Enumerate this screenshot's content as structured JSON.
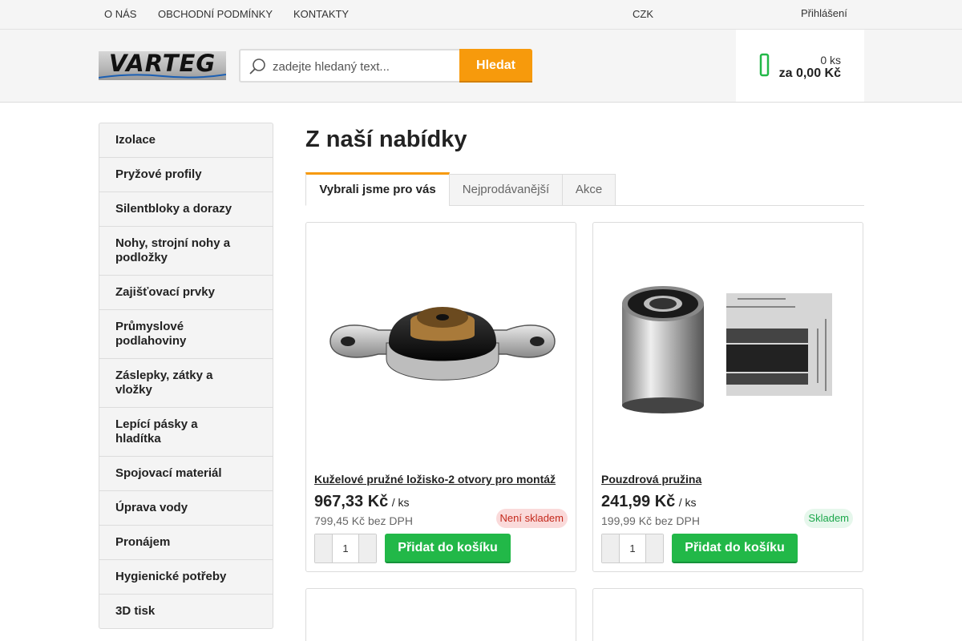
{
  "topbar": {
    "links": [
      "O NÁS",
      "OBCHODNÍ PODMÍNKY",
      "KONTAKTY"
    ],
    "currency_icon": "",
    "currency": "CZK",
    "currency_caret": "",
    "login_icon": "",
    "login": "Přihlášení"
  },
  "header": {
    "logo_text": "VARTEG",
    "search_placeholder": "zadejte hledaný text...",
    "search_button": "Hledat",
    "cart_icon": "",
    "cart_qty": "0 ks",
    "cart_total": "za 0,00 Kč",
    "accent": "#f79a0c"
  },
  "sidebar": {
    "items": [
      {
        "label": "Izolace",
        "arrow": ""
      },
      {
        "label": "Pryžové profily",
        "arrow": ""
      },
      {
        "label": "Silentbloky a dorazy",
        "arrow": ""
      },
      {
        "label": "Nohy, strojní nohy a podložky",
        "arrow": ""
      },
      {
        "label": "Zajišťovací prvky",
        "arrow": ""
      },
      {
        "label": "Průmyslové podlahoviny",
        "arrow": ""
      },
      {
        "label": "Záslepky, zátky a vložky",
        "arrow": ""
      },
      {
        "label": "Lepící pásky a hladítka",
        "arrow": ""
      },
      {
        "label": "Spojovací materiál",
        "arrow": ""
      },
      {
        "label": "Úprava vody",
        "arrow": ""
      },
      {
        "label": "Pronájem",
        "arrow": ""
      },
      {
        "label": "Hygienické potřeby",
        "arrow": ""
      },
      {
        "label": "3D tisk",
        "arrow": ""
      }
    ]
  },
  "main": {
    "title": "Z naší nabídky",
    "tabs": [
      {
        "label": "Vybrali jsme pro vás",
        "active": true
      },
      {
        "label": "Nejprodávanější",
        "active": false
      },
      {
        "label": "Akce",
        "active": false
      }
    ],
    "products": [
      {
        "name": "Kuželové pružné ložisko-2 otvory pro montáž",
        "price": "967,33 Kč",
        "unit": "/ ks",
        "price_net": "799,45 Kč bez DPH",
        "stock": "Není skladem",
        "qty": "1",
        "qty_minus": "",
        "qty_plus": "",
        "add": "Přidat do košíku",
        "image_icon": "conical-bearing-image"
      },
      {
        "name": "Pouzdrová pružina",
        "price": "241,99 Kč",
        "unit": "/ ks",
        "price_net": "199,99 Kč bez DPH",
        "stock": "Skladem",
        "qty": "1",
        "qty_minus": "",
        "qty_plus": "",
        "add": "Přidat do košíku",
        "image_icon": "bushing-spring-image"
      }
    ]
  },
  "colors": {
    "primary_green": "#22b848",
    "stock_red": "#c4291c",
    "stock_green": "#1da74c"
  }
}
